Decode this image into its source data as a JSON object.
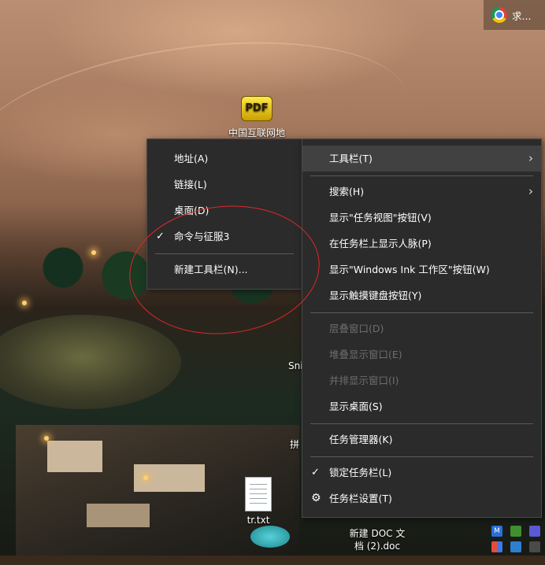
{
  "desktop": {
    "icons": [
      {
        "label": "中国互联网地",
        "glyph": "PDF"
      },
      {
        "label": "tr.txt"
      },
      {
        "label": "新建 DOC 文\n档 (2).doc"
      }
    ],
    "partial_labels": [
      "Sni",
      "拼"
    ]
  },
  "chrome_tab": {
    "label": "求..."
  },
  "toolbar_submenu": {
    "items": [
      {
        "label": "地址(A)",
        "checked": false
      },
      {
        "label": "链接(L)",
        "checked": false
      },
      {
        "label": "桌面(D)",
        "checked": false
      },
      {
        "label": "命令与征服3",
        "checked": true
      },
      {
        "label": "新建工具栏(N)...",
        "checked": false
      }
    ]
  },
  "taskbar_menu": {
    "items": [
      {
        "label": "工具栏(T)",
        "submenu": true,
        "highlighted": true
      },
      {
        "label": "搜索(H)",
        "submenu": true
      },
      {
        "label": "显示\"任务视图\"按钮(V)"
      },
      {
        "label": "在任务栏上显示人脉(P)"
      },
      {
        "label": "显示\"Windows Ink 工作区\"按钮(W)"
      },
      {
        "label": "显示触摸键盘按钮(Y)"
      },
      {
        "label": "层叠窗口(D)",
        "disabled": true
      },
      {
        "label": "堆叠显示窗口(E)",
        "disabled": true
      },
      {
        "label": "并排显示窗口(I)",
        "disabled": true
      },
      {
        "label": "显示桌面(S)"
      },
      {
        "label": "任务管理器(K)"
      },
      {
        "label": "锁定任务栏(L)",
        "checked": true
      },
      {
        "label": "任务栏设置(T)",
        "icon": "gear-icon"
      }
    ]
  },
  "glyphs": {
    "check": "✓",
    "arrow": "›",
    "gear": "⚙"
  },
  "colors": {
    "menu_bg": "#2b2b2b",
    "menu_highlight": "#414141",
    "disabled_text": "#6d6d6d",
    "annotation": "#e0262a"
  }
}
